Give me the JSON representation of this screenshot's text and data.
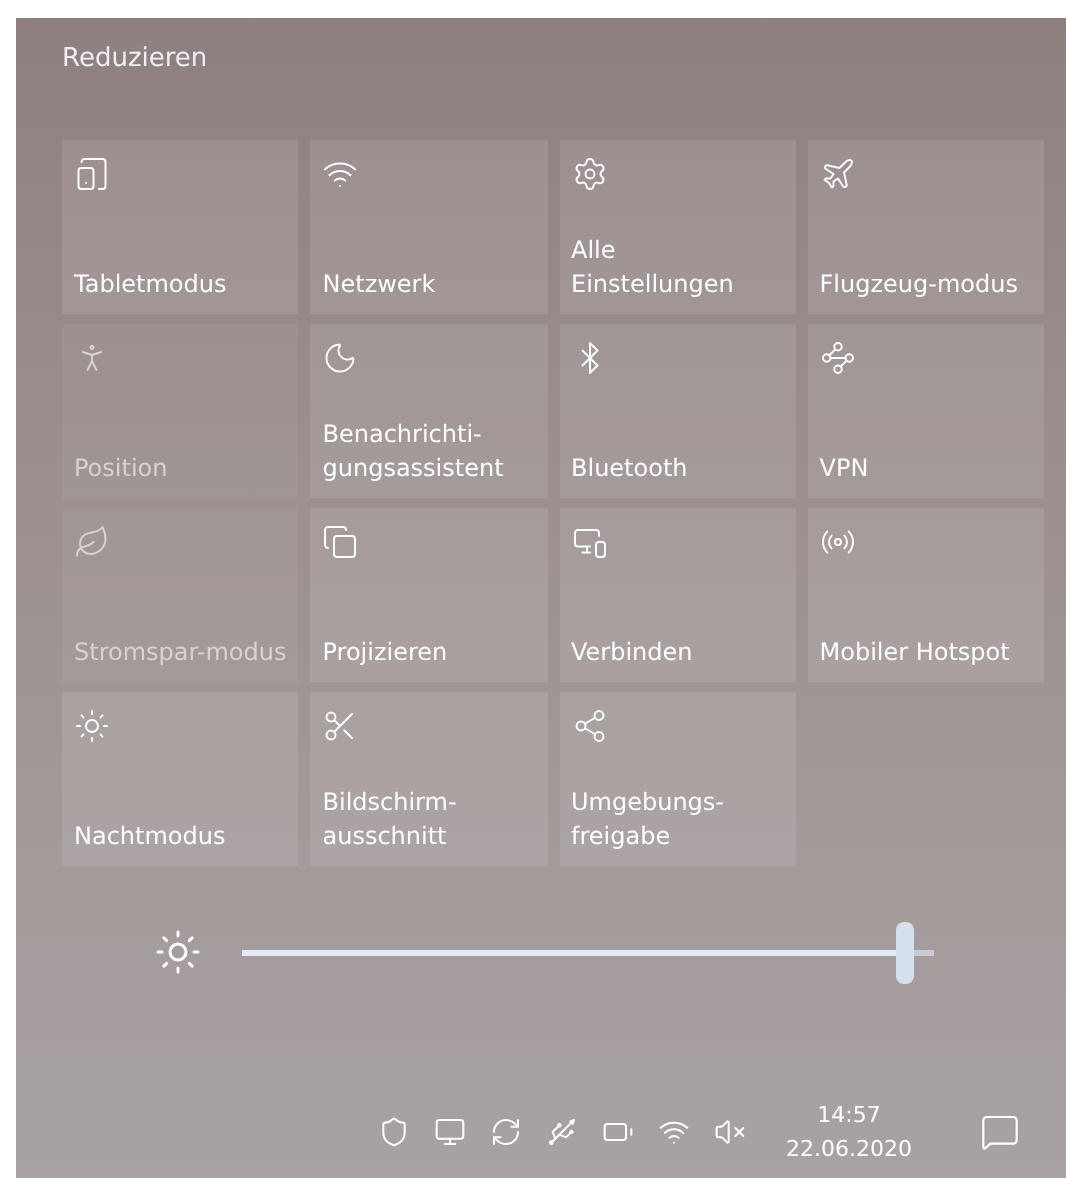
{
  "header": {
    "collapse": "Reduzieren"
  },
  "tiles": [
    {
      "label": "Tabletmodus",
      "disabled": false
    },
    {
      "label": "Netzwerk",
      "disabled": false
    },
    {
      "label": "Alle Einstellungen",
      "disabled": false
    },
    {
      "label": "Flugzeug-modus",
      "disabled": false
    },
    {
      "label": "Position",
      "disabled": true
    },
    {
      "label": "Benachrichti-gungsassistent",
      "disabled": false
    },
    {
      "label": "Bluetooth",
      "disabled": false
    },
    {
      "label": "VPN",
      "disabled": false
    },
    {
      "label": "Stromspar-modus",
      "disabled": true
    },
    {
      "label": "Projizieren",
      "disabled": false
    },
    {
      "label": "Verbinden",
      "disabled": false
    },
    {
      "label": "Mobiler Hotspot",
      "disabled": false
    },
    {
      "label": "Nachtmodus",
      "disabled": false
    },
    {
      "label": "Bildschirm-ausschnitt",
      "disabled": false
    },
    {
      "label": "Umgebungs-freigabe",
      "disabled": false
    }
  ],
  "brightness": {
    "level": 0.97
  },
  "taskbar": {
    "time": "14:57",
    "date": "22.06.2020"
  }
}
